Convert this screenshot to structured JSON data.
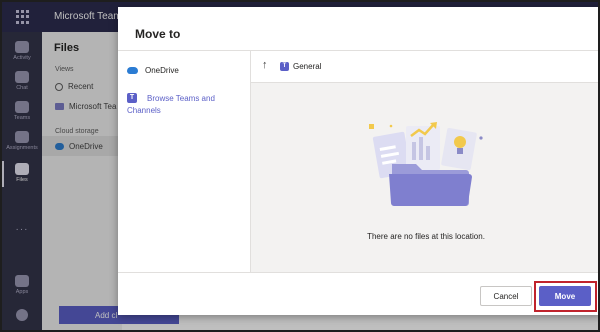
{
  "app": {
    "title": "Microsoft Teams"
  },
  "rail": {
    "items": [
      {
        "label": "Activity",
        "icon": "bell-icon"
      },
      {
        "label": "Chat",
        "icon": "chat-icon"
      },
      {
        "label": "Teams",
        "icon": "teams-icon"
      },
      {
        "label": "Assignments",
        "icon": "assignments-icon"
      },
      {
        "label": "Files",
        "icon": "file-icon"
      },
      {
        "label": "Apps",
        "icon": "apps-icon"
      }
    ],
    "more": "···"
  },
  "files_panel": {
    "title": "Files",
    "views_header": "Views",
    "recent": "Recent",
    "microsoft_teams": "Microsoft Tea",
    "cloud_storage_header": "Cloud storage",
    "onedrive": "OneDrive",
    "add_button": "Add cl"
  },
  "dialog": {
    "title": "Move to",
    "nav": {
      "onedrive": "OneDrive",
      "browse_teams_line1": "Browse Teams and",
      "browse_teams_line2": "Channels"
    },
    "location": {
      "up_icon": "↑",
      "channel": "General"
    },
    "empty_message": "There are no files at this location.",
    "buttons": {
      "cancel": "Cancel",
      "move": "Move"
    }
  },
  "colors": {
    "brand": "#5b5fc7",
    "titlebar": "#2d2c4f",
    "rail": "#33344a",
    "highlight": "#c0232c"
  }
}
